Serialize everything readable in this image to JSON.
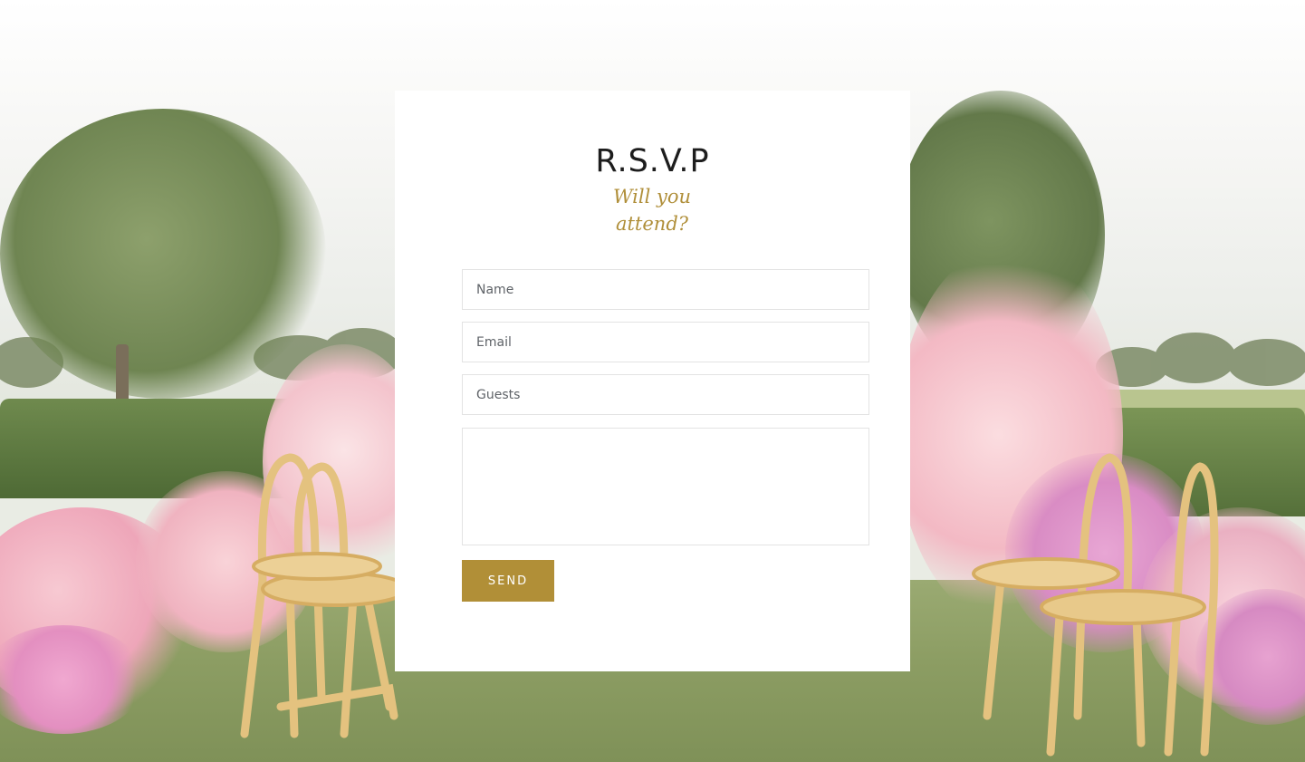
{
  "rsvp": {
    "title": "R.S.V.P",
    "subtitle": "Will you attend?",
    "fields": {
      "name_placeholder": "Name",
      "email_placeholder": "Email",
      "guests_placeholder": "Guests",
      "message_placeholder": ""
    },
    "send_label": "SEND"
  },
  "colors": {
    "accent": "#b18f37",
    "subtitle": "#b08f3a",
    "card_bg": "#ffffff"
  }
}
